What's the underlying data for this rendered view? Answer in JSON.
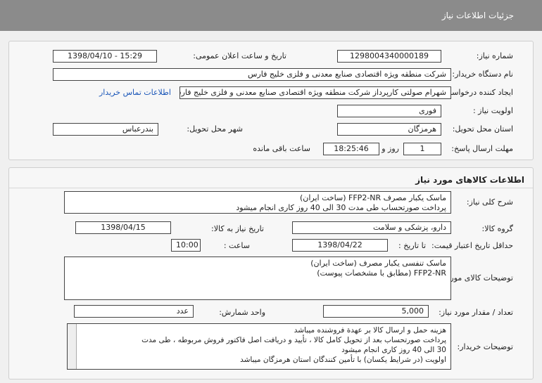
{
  "header": {
    "title": "جزئیات اطلاعات نیاز"
  },
  "info": {
    "need_number_label": "شماره نیاز:",
    "need_number": "1298004340000189",
    "announce_label": "تاریخ و ساعت اعلان عمومی:",
    "announce_value": "1398/04/10 - 15:29",
    "buyer_label": "نام دستگاه خریدار:",
    "buyer_value": "شرکت منطقه ویژه اقتصادی صنایع معدنی و فلزی خلیج فارس",
    "requester_label": "ایجاد کننده درخواست:",
    "requester_value": "شهرام صولتی کارپرداز شرکت منطقه ویژه اقتصادی صنایع معدنی و فلزی خلیج فارس",
    "contact_link": "اطلاعات تماس خریدار",
    "priority_label": "اولویت نیاز :",
    "priority_value": "فوری",
    "province_label": "استان محل تحویل:",
    "province_value": "هرمزگان",
    "city_label": "شهر محل تحویل:",
    "city_value": "بندرعباس",
    "deadline_label": "مهلت ارسال پاسخ:",
    "deadline_days": "1",
    "days_text": "روز و",
    "deadline_time": "18:25:46",
    "remaining_text": "ساعت باقی مانده"
  },
  "goods": {
    "section_title": "اطلاعات کالاهای مورد نیاز",
    "summary_label": "شرح کلی نیاز:",
    "summary_lines": [
      "ماسک یکبار مصرف FFP2-NR (ساخت ایران)",
      "پرداخت صورتحساب طی مدت 30 الی 40 روز کاری انجام میشود"
    ],
    "group_label": "گروه کالا:",
    "group_value": "دارو، پزشکی و سلامت",
    "need_date_label": "تاریخ نیاز به کالا:",
    "need_date_value": "1398/04/15",
    "min_price_label": "حداقل تاریخ اعتبار قیمت:",
    "to_date_label": "تا تاریخ :",
    "to_date_value": "1398/04/22",
    "time_label": "ساعت :",
    "time_value": "10:00",
    "item_desc_label": "توضیحات کالای مورد نیاز:",
    "item_desc_lines": [
      "ماسک تنفسی یکبار مصرف (ساخت ایران)",
      "FFP2-NR (مطابق با مشخصات پیوست)"
    ],
    "qty_label": "تعداد / مقدار مورد نیاز:",
    "qty_value": "5,000",
    "unit_label": "واحد شمارش:",
    "unit_value": "عدد",
    "buyer_notes_label": "توضیحات خریدار:",
    "buyer_notes_lines": [
      "هزینه حمل و ارسال کالا بر عهدة فروشنده میباشد",
      "پرداخت صورتحساب بعد از تحویل کامل کالا ، تأیید و دریافت اصل فاکتور فروش مربوطه ، طی مدت",
      "30 الی 40 روز کاری انجام میشود",
      "اولویت (در شرایط یکسان) با تأمین کنندگان استان هرمزگان میباشد"
    ]
  }
}
